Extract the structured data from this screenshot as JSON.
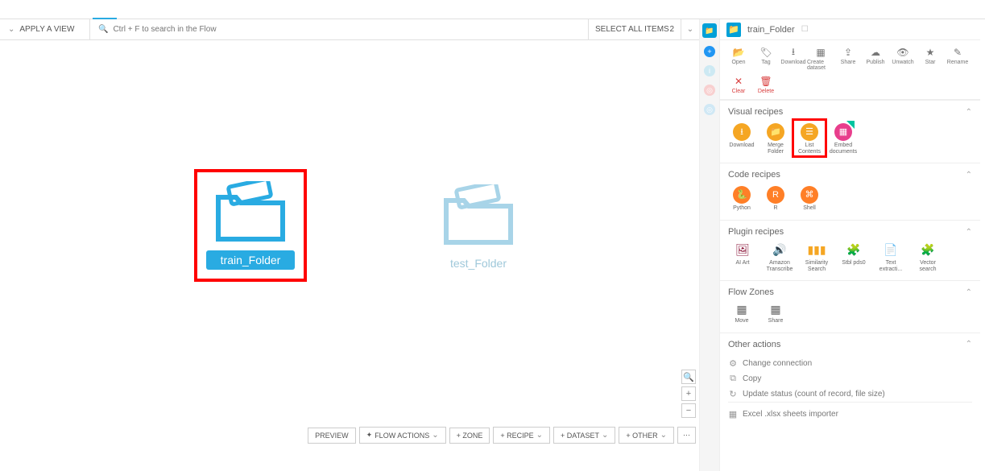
{
  "topbar": {
    "apply_view": "APPLY A VIEW",
    "search_placeholder": "Ctrl + F to search in the Flow",
    "select_all": "SELECT ALL ITEMS",
    "select_count": "2"
  },
  "folders": {
    "train": {
      "label": "train_Folder"
    },
    "test": {
      "label": "test_Folder"
    }
  },
  "bottombar": {
    "preview": "PREVIEW",
    "flow_actions": "FLOW ACTIONS",
    "zone": "+ ZONE",
    "recipe": "+ RECIPE",
    "dataset": "+ DATASET",
    "other": "+ OTHER"
  },
  "rp": {
    "title": "train_Folder",
    "actions_row1": [
      {
        "name": "open",
        "label": "Open"
      },
      {
        "name": "tag",
        "label": "Tag"
      },
      {
        "name": "download",
        "label": "Download"
      },
      {
        "name": "create-dataset",
        "label": "Create dataset"
      },
      {
        "name": "share",
        "label": "Share"
      },
      {
        "name": "publish",
        "label": "Publish"
      },
      {
        "name": "unwatch",
        "label": "Unwatch"
      },
      {
        "name": "star",
        "label": "Star"
      },
      {
        "name": "rename",
        "label": "Rename"
      }
    ],
    "actions_row2": [
      {
        "name": "clear",
        "label": "Clear"
      },
      {
        "name": "delete",
        "label": "Delete"
      }
    ],
    "visual": {
      "title": "Visual recipes",
      "items": [
        {
          "name": "download",
          "label": "Download",
          "color": "c-yellow"
        },
        {
          "name": "merge-folder",
          "label": "Merge Folder",
          "color": "c-yellow"
        },
        {
          "name": "list-contents",
          "label": "List Contents",
          "color": "c-yellow",
          "highlight": true
        },
        {
          "name": "embed-documents",
          "label": "Embed documents",
          "color": "c-pink"
        }
      ]
    },
    "code": {
      "title": "Code recipes",
      "items": [
        {
          "name": "python",
          "label": "Python"
        },
        {
          "name": "r",
          "label": "R"
        },
        {
          "name": "shell",
          "label": "Shell"
        }
      ]
    },
    "plugin": {
      "title": "Plugin recipes",
      "items": [
        {
          "name": "ai-art",
          "label": "AI Art"
        },
        {
          "name": "amazon-transcribe",
          "label": "Amazon Transcribe"
        },
        {
          "name": "similarity-search",
          "label": "Similarity Search"
        },
        {
          "name": "stbi",
          "label": "Stbl pds0"
        },
        {
          "name": "text-extract",
          "label": "Text extracti..."
        },
        {
          "name": "vector-search",
          "label": "Vector search"
        }
      ]
    },
    "flowzones": {
      "title": "Flow Zones",
      "items": [
        {
          "name": "move",
          "label": "Move"
        },
        {
          "name": "share",
          "label": "Share"
        }
      ]
    },
    "other": {
      "title": "Other actions",
      "items": [
        {
          "name": "change-connection",
          "label": "Change connection"
        },
        {
          "name": "copy",
          "label": "Copy"
        },
        {
          "name": "update-status",
          "label": "Update status (count of record, file size)"
        },
        {
          "name": "excel-importer",
          "label": "Excel .xlsx sheets importer"
        }
      ]
    }
  }
}
